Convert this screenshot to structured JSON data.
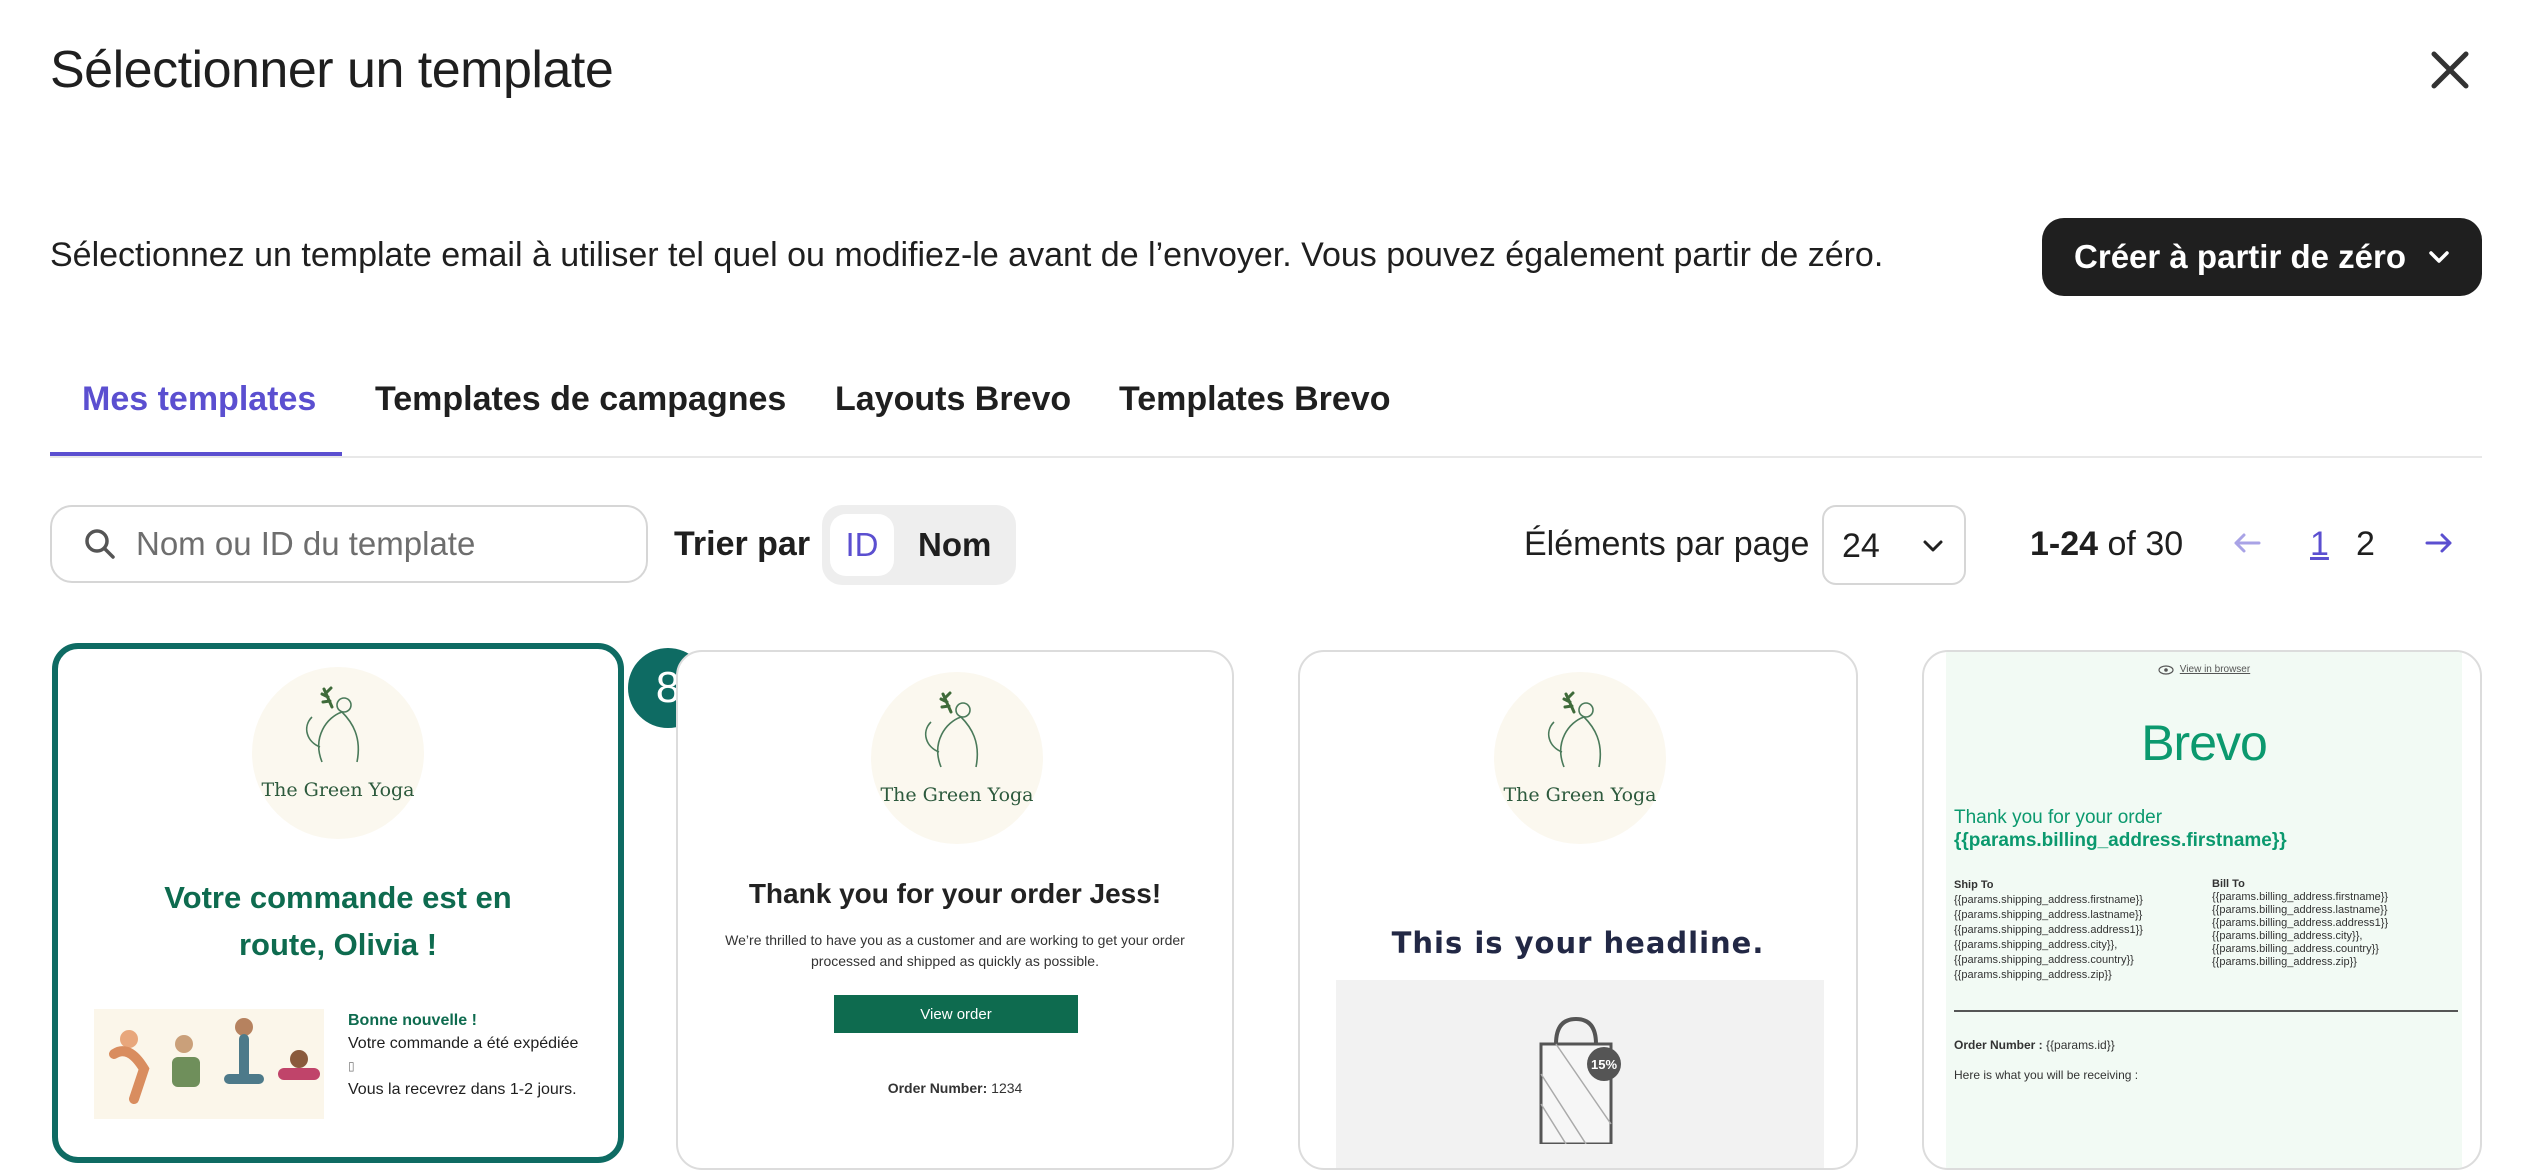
{
  "modal": {
    "title": "Sélectionner un template",
    "description": "Sélectionnez un template email à utiliser tel quel ou modifiez-le avant de l’envoyer. Vous pouvez également partir de zéro.",
    "create_button": "Créer à partir de zéro"
  },
  "tabs": [
    {
      "label": "Mes templates",
      "active": true
    },
    {
      "label": "Templates de campagnes",
      "active": false
    },
    {
      "label": "Layouts Brevo",
      "active": false
    },
    {
      "label": "Templates Brevo",
      "active": false
    }
  ],
  "toolbar": {
    "search_placeholder": "Nom ou ID du template",
    "sort_label": "Trier par",
    "sort_options": [
      "ID",
      "Nom"
    ],
    "sort_selected": "ID",
    "per_page_label": "Éléments par page",
    "per_page_value": "24",
    "range_bold": "1-24",
    "range_rest": "of 30",
    "pages": [
      "1",
      "2"
    ],
    "current_page": "1"
  },
  "selection_badge": "8",
  "templates": [
    {
      "logo_text": "The Green Yoga",
      "headline_1": "Votre commande est en",
      "headline_2": "route, Olivia !",
      "good_news": "Bonne nouvelle !",
      "line_1": "Votre commande a été expédiée",
      "line_2": "Vous la recevrez dans 1-2 jours."
    },
    {
      "logo_text": "The Green Yoga",
      "headline": "Thank you for your order Jess!",
      "body_1": "We’re thrilled to have you as a customer and are working to get your order",
      "body_2": "processed and shipped as quickly as possible.",
      "button": "View order",
      "order_label": "Order Number:",
      "order_value": "1234"
    },
    {
      "logo_text": "The Green Yoga",
      "headline": "This is your headline.",
      "discount": "15%"
    },
    {
      "view_in_browser": "View in browser",
      "brand": "Brevo",
      "thank_1": "Thank you for your order",
      "thank_2": "{{params.billing_address.firstname}}",
      "ship_to_label": "Ship To",
      "ship_to": [
        "{{params.shipping_address.firstname}}",
        "{{params.shipping_address.lastname}}",
        "{{params.shipping_address.address1}}",
        "{{params.shipping_address.city}},",
        "{{params.shipping_address.country}}",
        "{{params.shipping_address.zip}}"
      ],
      "bill_to_label": "Bill To",
      "bill_to": [
        "{{params.billing_address.firstname}}",
        "{{params.billing_address.lastname}}",
        "{{params.billing_address.address1}}",
        "{{params.billing_address.city}},",
        "{{params.billing_address.country}}",
        "{{params.billing_address.zip}}"
      ],
      "order_label": "Order Number :",
      "order_value": "{{params.id}}",
      "receiving": "Here is what you will be receiving :"
    }
  ],
  "colors": {
    "accent": "#5b4fd0",
    "selected": "#0e6b63",
    "brevo_green": "#0b996e",
    "dark_button": "#1f1f1f"
  }
}
